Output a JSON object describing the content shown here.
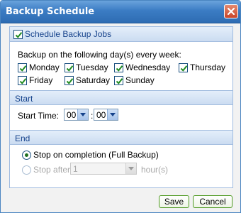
{
  "window": {
    "title": "Backup Schedule"
  },
  "schedule": {
    "enable_label": "Schedule Backup Jobs",
    "enabled": true,
    "days_prompt": "Backup on the following day(s) every week:",
    "days": [
      {
        "label": "Monday",
        "checked": true
      },
      {
        "label": "Tuesday",
        "checked": true
      },
      {
        "label": "Wednesday",
        "checked": true
      },
      {
        "label": "Thursday",
        "checked": true
      },
      {
        "label": "Friday",
        "checked": true
      },
      {
        "label": "Saturday",
        "checked": true
      },
      {
        "label": "Sunday",
        "checked": true
      }
    ]
  },
  "start": {
    "section_title": "Start",
    "time_label": "Start Time:",
    "hour": "00",
    "separator": ":",
    "minute": "00"
  },
  "end": {
    "section_title": "End",
    "option_completion": "Stop on completion (Full Backup)",
    "option_after": "Stop after",
    "hours_value": "1",
    "hours_unit": "hour(s)",
    "selected": "completion"
  },
  "footer": {
    "save_label": "Save",
    "cancel_label": "Cancel"
  },
  "colors": {
    "title_bar": "#3b7cc4",
    "panel_header_text": "#15428b",
    "button_border": "#4f9a22",
    "check": "#1f8a1f"
  },
  "icons": {
    "close": "close-icon",
    "checkmark": "checkmark-icon",
    "dropdown": "chevron-down-icon"
  }
}
